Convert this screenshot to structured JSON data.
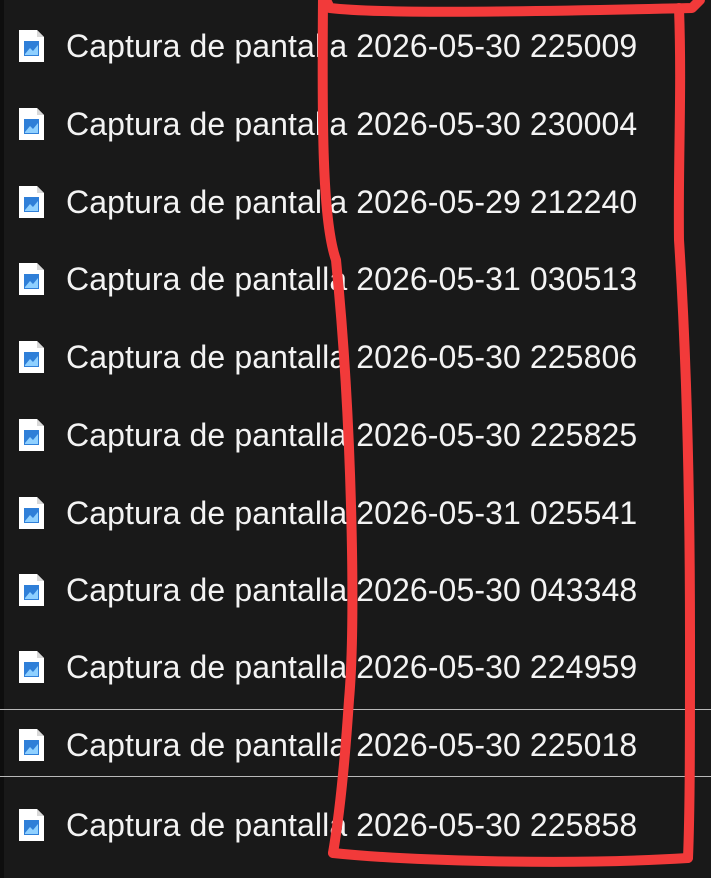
{
  "colors": {
    "background": "#191919",
    "text": "#f3f3f3",
    "annotation_stroke": "#f23a3a",
    "icon_accent": "#2f7fd8"
  },
  "file_list": {
    "icon": "image-file-icon",
    "items": [
      {
        "name": "Captura de pantalla 2026-05-30 225009"
      },
      {
        "name": "Captura de pantalla 2026-05-30 230004"
      },
      {
        "name": "Captura de pantalla 2026-05-29 212240"
      },
      {
        "name": "Captura de pantalla 2026-05-31 030513"
      },
      {
        "name": "Captura de pantalla 2026-05-30 225806"
      },
      {
        "name": "Captura de pantalla 2026-05-30 225825"
      },
      {
        "name": "Captura de pantalla 2026-05-31 025541"
      },
      {
        "name": "Captura de pantalla 2026-05-30 043348"
      },
      {
        "name": "Captura de pantalla 2026-05-30 224959"
      },
      {
        "name": "Captura de pantalla 2026-05-30 225018"
      },
      {
        "name": "Captura de pantalla 2026-05-30 225858"
      }
    ]
  }
}
